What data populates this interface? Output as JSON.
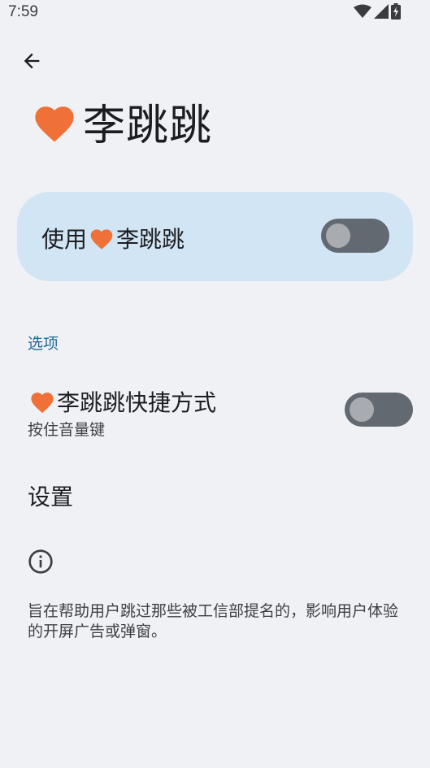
{
  "status_bar": {
    "time": "7:59"
  },
  "header": {
    "title": "李跳跳"
  },
  "master_switch": {
    "label_prefix": "使用",
    "label_name": "李跳跳",
    "enabled": false
  },
  "section": {
    "title": "选项"
  },
  "shortcut": {
    "name": "李跳跳",
    "title_suffix": "快捷方式",
    "subtitle": "按住音量键",
    "enabled": false
  },
  "settings": {
    "label": "设置"
  },
  "info": {
    "text": "旨在帮助用户跳过那些被工信部提名的，影响用户体验的开屏广告或弹窗。"
  },
  "colors": {
    "accent": "#1f6b93",
    "heart": "#ef7137",
    "card_bg": "#d2e5f4",
    "switch_track": "#636970",
    "switch_thumb": "#a8abb0",
    "background": "#f0f1f4"
  },
  "icons": [
    "wifi-icon",
    "signal-icon",
    "battery-charging-icon",
    "back-arrow-icon",
    "heart-icon",
    "info-icon"
  ]
}
